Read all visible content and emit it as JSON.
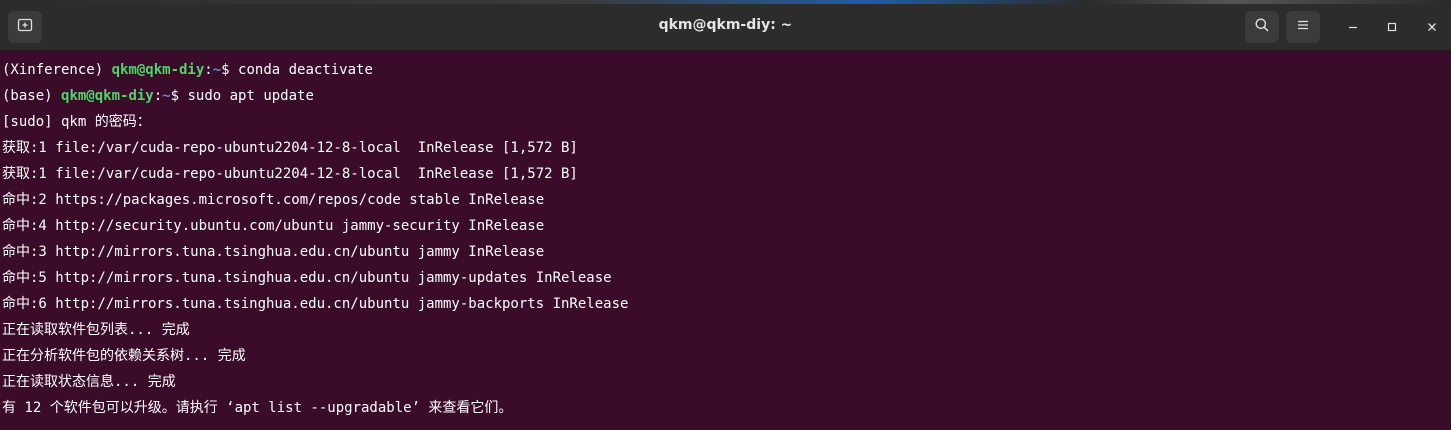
{
  "window": {
    "title": "qkm@qkm-diy: ~"
  },
  "titlebar": {
    "new_tab_icon": "new-tab-icon",
    "search_icon": "search-icon",
    "menu_icon": "hamburger-menu-icon",
    "minimize_icon": "minimize-icon",
    "maximize_icon": "maximize-icon",
    "close_icon": "close-icon"
  },
  "colors": {
    "terminal_bg": "#3a0c2a",
    "prompt_user": "#4fd36a",
    "prompt_path": "#5a8fd6",
    "text": "#ffffff"
  },
  "terminal": {
    "prompts": [
      {
        "env": "(Xinference) ",
        "user": "qkm@qkm-diy",
        "sep": ":",
        "path": "~",
        "symbol": "$ ",
        "command": "conda deactivate"
      },
      {
        "env": "(base) ",
        "user": "qkm@qkm-diy",
        "sep": ":",
        "path": "~",
        "symbol": "$ ",
        "command": "sudo apt update"
      }
    ],
    "output": [
      "[sudo] qkm 的密码：",
      "获取:1 file:/var/cuda-repo-ubuntu2204-12-8-local  InRelease [1,572 B]",
      "获取:1 file:/var/cuda-repo-ubuntu2204-12-8-local  InRelease [1,572 B]",
      "命中:2 https://packages.microsoft.com/repos/code stable InRelease",
      "命中:4 http://security.ubuntu.com/ubuntu jammy-security InRelease",
      "命中:3 http://mirrors.tuna.tsinghua.edu.cn/ubuntu jammy InRelease",
      "命中:5 http://mirrors.tuna.tsinghua.edu.cn/ubuntu jammy-updates InRelease",
      "命中:6 http://mirrors.tuna.tsinghua.edu.cn/ubuntu jammy-backports InRelease",
      "正在读取软件包列表... 完成",
      "正在分析软件包的依赖关系树... 完成",
      "正在读取状态信息... 完成",
      "有 12 个软件包可以升级。请执行 ‘apt list --upgradable’ 来查看它们。"
    ]
  }
}
